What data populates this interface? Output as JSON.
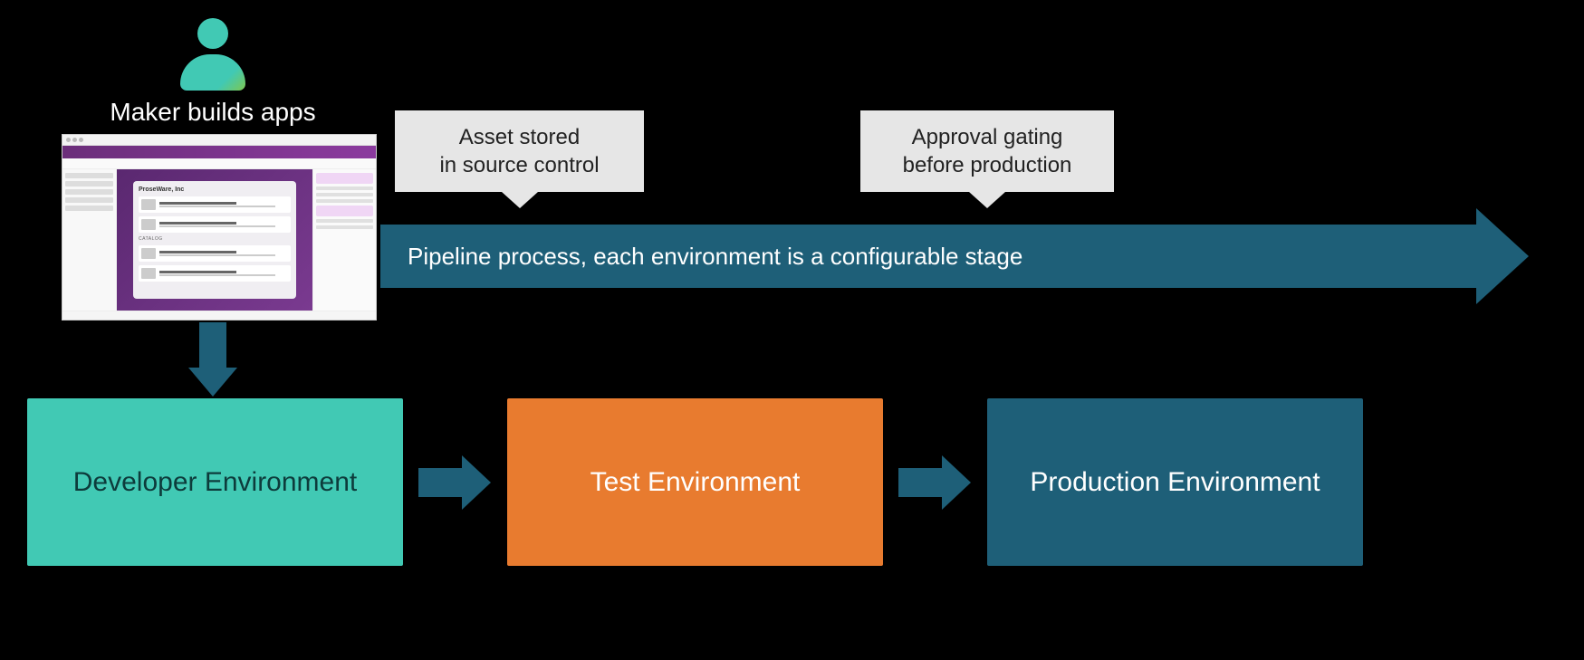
{
  "maker_label": "Maker builds apps",
  "thumbnail": {
    "company": "ProseWare, Inc",
    "catalog_label": "CATALOG"
  },
  "callouts": {
    "asset_line1": "Asset stored",
    "asset_line2": "in source control",
    "approval_line1": "Approval gating",
    "approval_line2": "before production"
  },
  "pipeline_text": "Pipeline process, each environment is a configurable stage",
  "environments": {
    "dev": "Developer Environment",
    "test": "Test Environment",
    "prod": "Production Environment"
  },
  "colors": {
    "teal": "#41c9b4",
    "dark_teal": "#1e5f78",
    "orange": "#e87b2f",
    "callout_bg": "#e6e6e6"
  }
}
